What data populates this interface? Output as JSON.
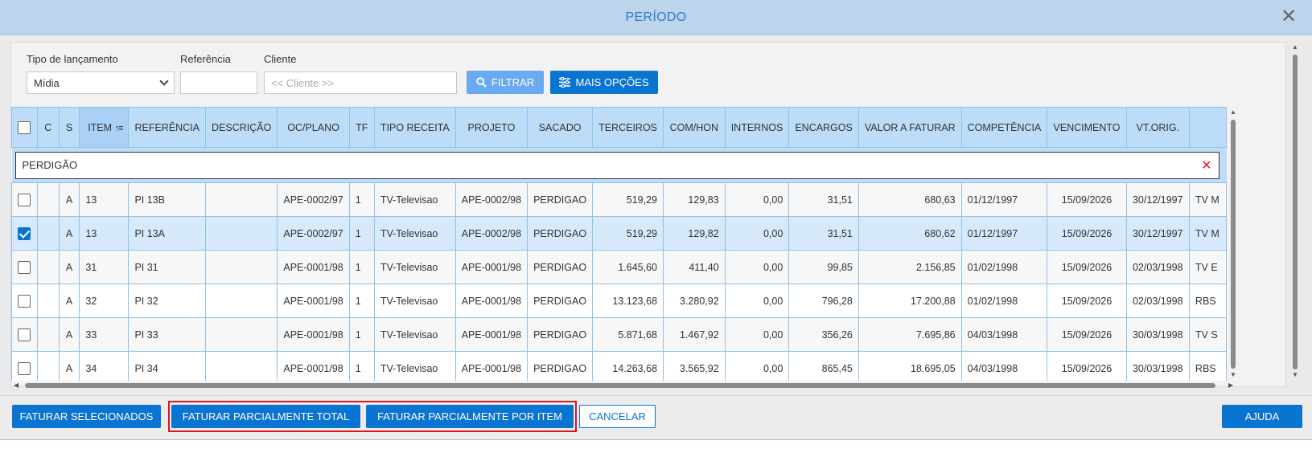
{
  "dialog": {
    "title": "PERÍODO"
  },
  "filters": {
    "tipo_label": "Tipo de lançamento",
    "tipo_value": "Mídia",
    "referencia_label": "Referência",
    "referencia_value": "",
    "cliente_label": "Cliente",
    "cliente_placeholder": "<< Cliente >>",
    "filter_button": "FILTRAR",
    "more_button": "MAIS OPÇÕES"
  },
  "table": {
    "columns": [
      "C",
      "S",
      "ITEM",
      "REFERÊNCIA",
      "DESCRIÇÃO",
      "OC/PLANO",
      "TF",
      "TIPO RECEITA",
      "PROJETO",
      "SACADO",
      "TERCEIROS",
      "COM/HON",
      "INTERNOS",
      "ENCARGOS",
      "VALOR A FATURAR",
      "COMPETÊNCIA",
      "VENCIMENTO",
      "VT.ORIG.",
      ""
    ],
    "search_value": "PERDIGÃO",
    "rows": [
      {
        "checked": false,
        "c": "",
        "s": "A",
        "item": "13",
        "ref": "PI 13B",
        "desc": "",
        "oc": "APE-0002/97",
        "tf": "1",
        "tipo": "TV-Televisao",
        "proj": "APE-0002/98",
        "sacado": "PERDIGAO",
        "terceiros": "519,29",
        "comhon": "129,83",
        "internos": "0,00",
        "encargos": "31,51",
        "valor": "680,63",
        "comp": "01/12/1997",
        "venc": "15/09/2026",
        "vtorig": "30/12/1997",
        "extra": "TV M"
      },
      {
        "checked": true,
        "c": "",
        "s": "A",
        "item": "13",
        "ref": "PI 13A",
        "desc": "",
        "oc": "APE-0002/97",
        "tf": "1",
        "tipo": "TV-Televisao",
        "proj": "APE-0002/98",
        "sacado": "PERDIGAO",
        "terceiros": "519,29",
        "comhon": "129,82",
        "internos": "0,00",
        "encargos": "31,51",
        "valor": "680,62",
        "comp": "01/12/1997",
        "venc": "15/09/2026",
        "vtorig": "30/12/1997",
        "extra": "TV M"
      },
      {
        "checked": false,
        "c": "",
        "s": "A",
        "item": "31",
        "ref": "PI 31",
        "desc": "",
        "oc": "APE-0001/98",
        "tf": "1",
        "tipo": "TV-Televisao",
        "proj": "APE-0001/98",
        "sacado": "PERDIGAO",
        "terceiros": "1.645,60",
        "comhon": "411,40",
        "internos": "0,00",
        "encargos": "99,85",
        "valor": "2.156,85",
        "comp": "01/02/1998",
        "venc": "15/09/2026",
        "vtorig": "02/03/1998",
        "extra": "TV E"
      },
      {
        "checked": false,
        "c": "",
        "s": "A",
        "item": "32",
        "ref": "PI 32",
        "desc": "",
        "oc": "APE-0001/98",
        "tf": "1",
        "tipo": "TV-Televisao",
        "proj": "APE-0001/98",
        "sacado": "PERDIGAO",
        "terceiros": "13.123,68",
        "comhon": "3.280,92",
        "internos": "0,00",
        "encargos": "796,28",
        "valor": "17.200,88",
        "comp": "01/02/1998",
        "venc": "15/09/2026",
        "vtorig": "02/03/1998",
        "extra": "RBS"
      },
      {
        "checked": false,
        "c": "",
        "s": "A",
        "item": "33",
        "ref": "PI 33",
        "desc": "",
        "oc": "APE-0001/98",
        "tf": "1",
        "tipo": "TV-Televisao",
        "proj": "APE-0001/98",
        "sacado": "PERDIGAO",
        "terceiros": "5.871,68",
        "comhon": "1.467,92",
        "internos": "0,00",
        "encargos": "356,26",
        "valor": "7.695,86",
        "comp": "04/03/1998",
        "venc": "15/09/2026",
        "vtorig": "30/03/1998",
        "extra": "TV S"
      },
      {
        "checked": false,
        "c": "",
        "s": "A",
        "item": "34",
        "ref": "PI 34",
        "desc": "",
        "oc": "APE-0001/98",
        "tf": "1",
        "tipo": "TV-Televisao",
        "proj": "APE-0001/98",
        "sacado": "PERDIGAO",
        "terceiros": "14.263,68",
        "comhon": "3.565,92",
        "internos": "0,00",
        "encargos": "865,45",
        "valor": "18.695,05",
        "comp": "04/03/1998",
        "venc": "15/09/2026",
        "vtorig": "30/03/1998",
        "extra": "RBS"
      }
    ]
  },
  "footer": {
    "faturar_selecionados": "FATURAR SELECIONADOS",
    "faturar_parcial_total": "FATURAR PARCIALMENTE TOTAL",
    "faturar_parcial_item": "FATURAR PARCIALMENTE POR ITEM",
    "cancelar": "CANCELAR",
    "ajuda": "AJUDA"
  },
  "colors": {
    "accent": "#0a74d1",
    "header_bg": "#bcdcf8",
    "title_bar": "#bcd4ec",
    "highlight": "#e0141e"
  },
  "icons": {
    "close": "close-icon",
    "dropdown": "chevron-down-icon",
    "filter": "search-icon",
    "more": "sliders-icon",
    "sort": "sort-ascending-icon",
    "clear": "clear-x-icon"
  }
}
